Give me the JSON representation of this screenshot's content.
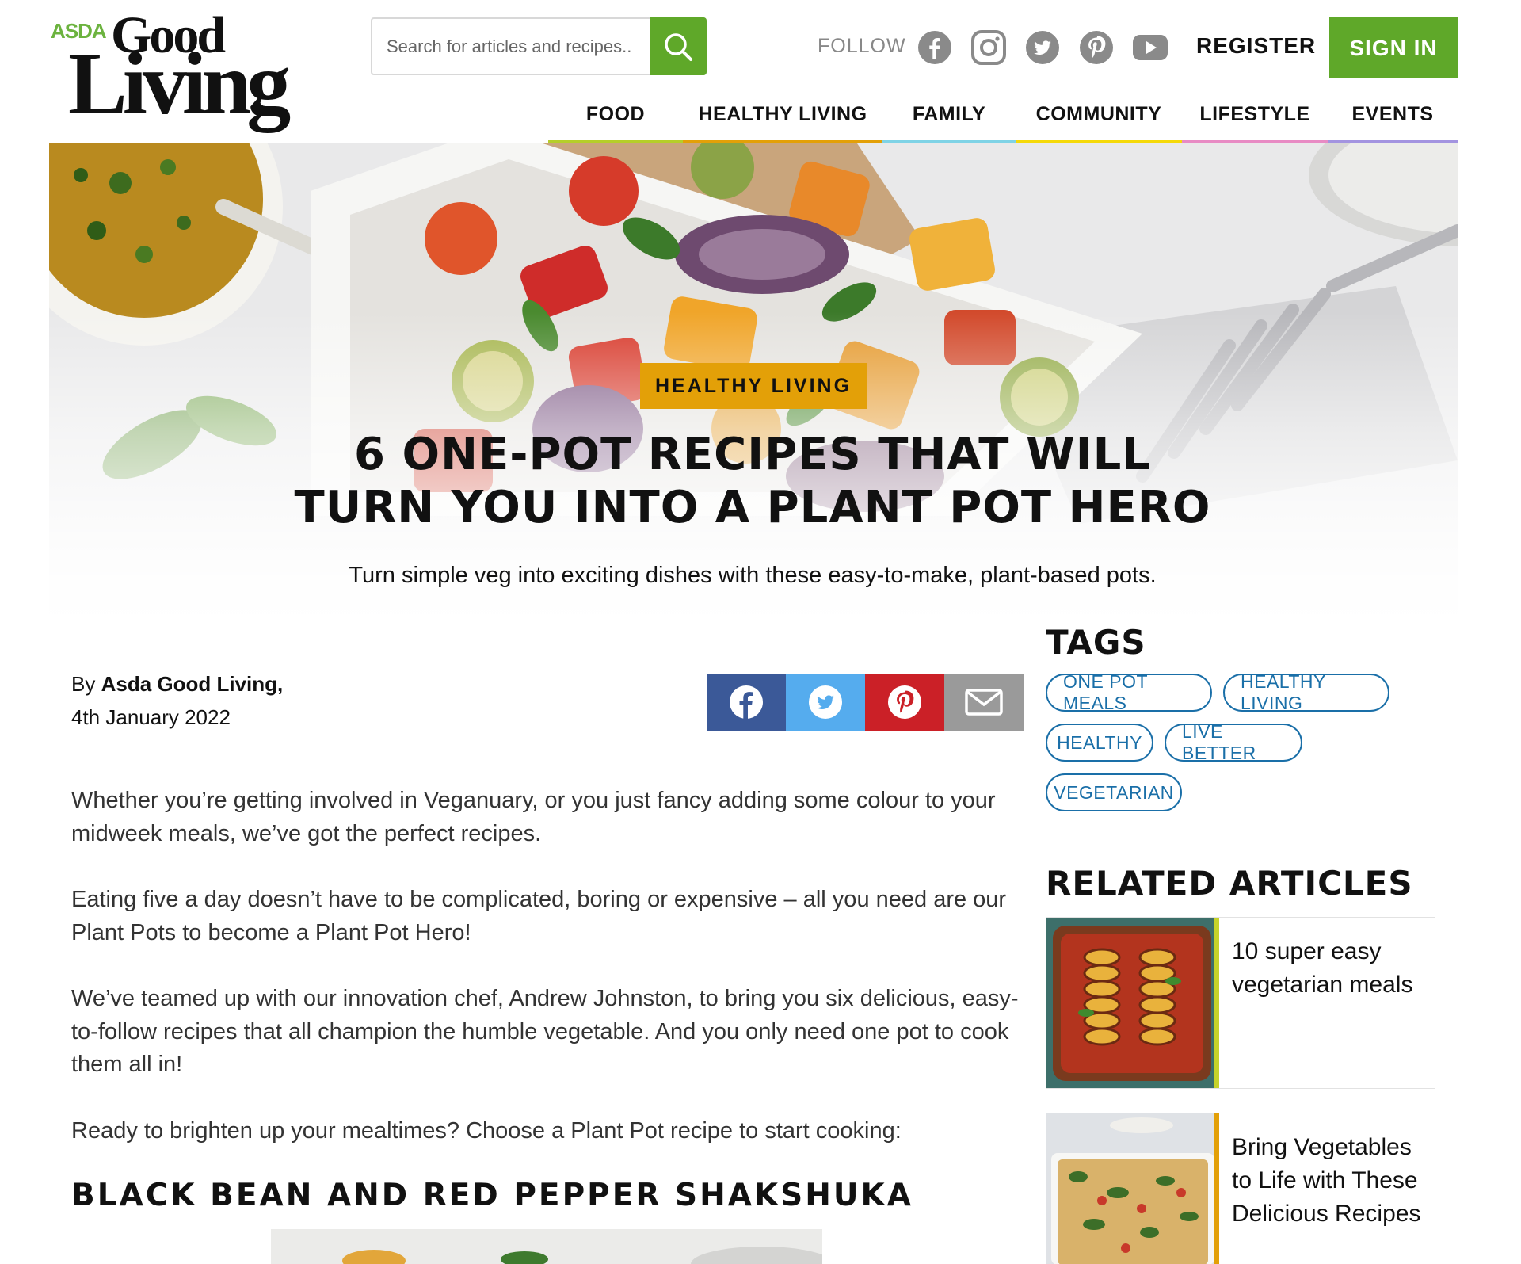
{
  "header": {
    "logo_asda": "ASDA",
    "logo_good": "Good",
    "logo_living": "Living",
    "search_placeholder": "Search for articles and recipes..",
    "follow_label": "FOLLOW",
    "social_icons": [
      "facebook-icon",
      "instagram-icon",
      "twitter-icon",
      "pinterest-icon",
      "youtube-icon"
    ],
    "register_label": "REGISTER",
    "signin_label": "SIGN IN"
  },
  "nav": {
    "items": [
      {
        "label": "FOOD",
        "color": "#b5cf2a"
      },
      {
        "label": "HEALTHY LIVING",
        "color": "#e3a008"
      },
      {
        "label": "FAMILY",
        "color": "#7fd3e6"
      },
      {
        "label": "COMMUNITY",
        "color": "#f5d90a"
      },
      {
        "label": "LIFESTYLE",
        "color": "#e88bc4"
      },
      {
        "label": "EVENTS",
        "color": "#a394e0"
      }
    ]
  },
  "hero": {
    "category": "HEALTHY LIVING",
    "headline_line1": "6 ONE-POT RECIPES THAT WILL",
    "headline_line2": "TURN YOU INTO A PLANT POT HERO",
    "subtitle": "Turn simple veg into exciting dishes with these easy-to-make, plant-based pots."
  },
  "article": {
    "by_prefix": "By",
    "author": "Asda Good Living,",
    "date": "4th January 2022",
    "share_icons": [
      "facebook-icon",
      "twitter-icon",
      "pinterest-icon",
      "email-icon"
    ],
    "paragraphs": [
      "Whether you’re getting involved in Veganuary, or you just fancy adding some colour to your midweek meals, we’ve got the perfect recipes.",
      "Eating five a day doesn’t have to be complicated, boring or expensive – all you need are our Plant Pots to become a Plant Pot Hero!",
      "We’ve teamed up with our innovation chef, Andrew Johnston, to bring you six delicious, easy-to-follow recipes that all champion the humble vegetable. And you only need one pot to cook them all in!",
      "Ready to brighten up your mealtimes? Choose a Plant Pot recipe to start cooking:"
    ],
    "section_heading": "BLACK BEAN AND RED PEPPER SHAKSHUKA"
  },
  "sidebar": {
    "tags_heading": "TAGS",
    "tags": [
      "ONE POT MEALS",
      "HEALTHY LIVING",
      "HEALTHY",
      "LIVE BETTER",
      "VEGETARIAN"
    ],
    "related_heading": "RELATED ARTICLES",
    "related": [
      {
        "title": "10 super easy vegetarian meals",
        "accent": "#c6d32a"
      },
      {
        "title": "Bring Vegetables to Life with These Delicious Recipes",
        "accent": "#e3a008"
      }
    ]
  },
  "colors": {
    "brand_green": "#5fa829",
    "link_blue": "#1a6fa8",
    "facebook": "#3b5998",
    "twitter": "#55acee",
    "pinterest": "#cb2027",
    "email": "#9a9a9a"
  }
}
